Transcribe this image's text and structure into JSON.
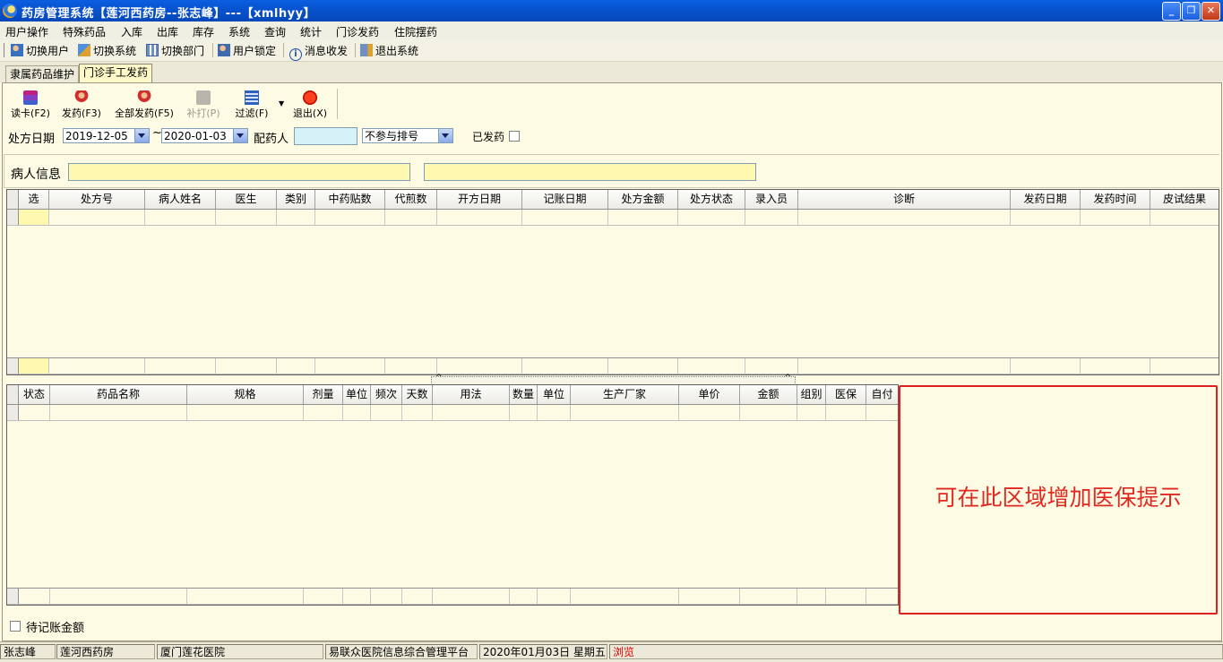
{
  "window": {
    "title": "药房管理系统【莲河西药房--张志峰】---【xmlhyy】"
  },
  "menu": [
    "用户操作",
    "特殊药品",
    "入库",
    "出库",
    "库存",
    "系统",
    "查询",
    "统计",
    "门诊发药",
    "住院摆药"
  ],
  "toolbar": {
    "switch_user": "切换用户",
    "switch_system": "切换系统",
    "switch_dept": "切换部门",
    "lock_user": "用户锁定",
    "messages": "消息收发",
    "exit_system": "退出系统"
  },
  "tabs": [
    "隶属药品维护",
    "门诊手工发药"
  ],
  "actions": {
    "read_card": "读卡(F2)",
    "dispense": "发药(F3)",
    "dispense_all": "全部发药(F5)",
    "reprint": "补打(P)",
    "filter": "过滤(F)",
    "exit": "退出(X)"
  },
  "filters": {
    "date_label": "处方日期",
    "date_from": "2019-12-05",
    "date_sep": "~",
    "date_to": "2020-01-03",
    "pharmacist_label": "配药人",
    "pharmacist_value": "",
    "queue_option": "不参与排号",
    "dispensed_label": "已发药",
    "dispensed_checked": false
  },
  "patient": {
    "label": "病人信息",
    "field1": "",
    "field2": ""
  },
  "prescription_grid": {
    "columns": [
      "选",
      "处方号",
      "病人姓名",
      "医生",
      "类别",
      "中药贴数",
      "代煎数",
      "开方日期",
      "记账日期",
      "处方金额",
      "处方状态",
      "录入员",
      "诊断",
      "发药日期",
      "发药时间",
      "皮试结果"
    ],
    "rows": []
  },
  "detail_grid": {
    "columns": [
      "状态",
      "药品名称",
      "规格",
      "剂量",
      "单位",
      "频次",
      "天数",
      "用法",
      "数量",
      "单位",
      "生产厂家",
      "单价",
      "金额",
      "组别",
      "医保",
      "自付"
    ],
    "rows": []
  },
  "insurance_hint": "可在此区域增加医保提示",
  "pending_amount": {
    "label": "待记账金额",
    "checked": false
  },
  "status_bar": {
    "user": "张志峰",
    "pharmacy": "莲河西药房",
    "hospital": "厦门莲花医院",
    "platform": "易联众医院信息综合管理平台",
    "datetime": "2020年01月03日 星期五",
    "mode": "浏览",
    "mode_color": "#e00000"
  }
}
